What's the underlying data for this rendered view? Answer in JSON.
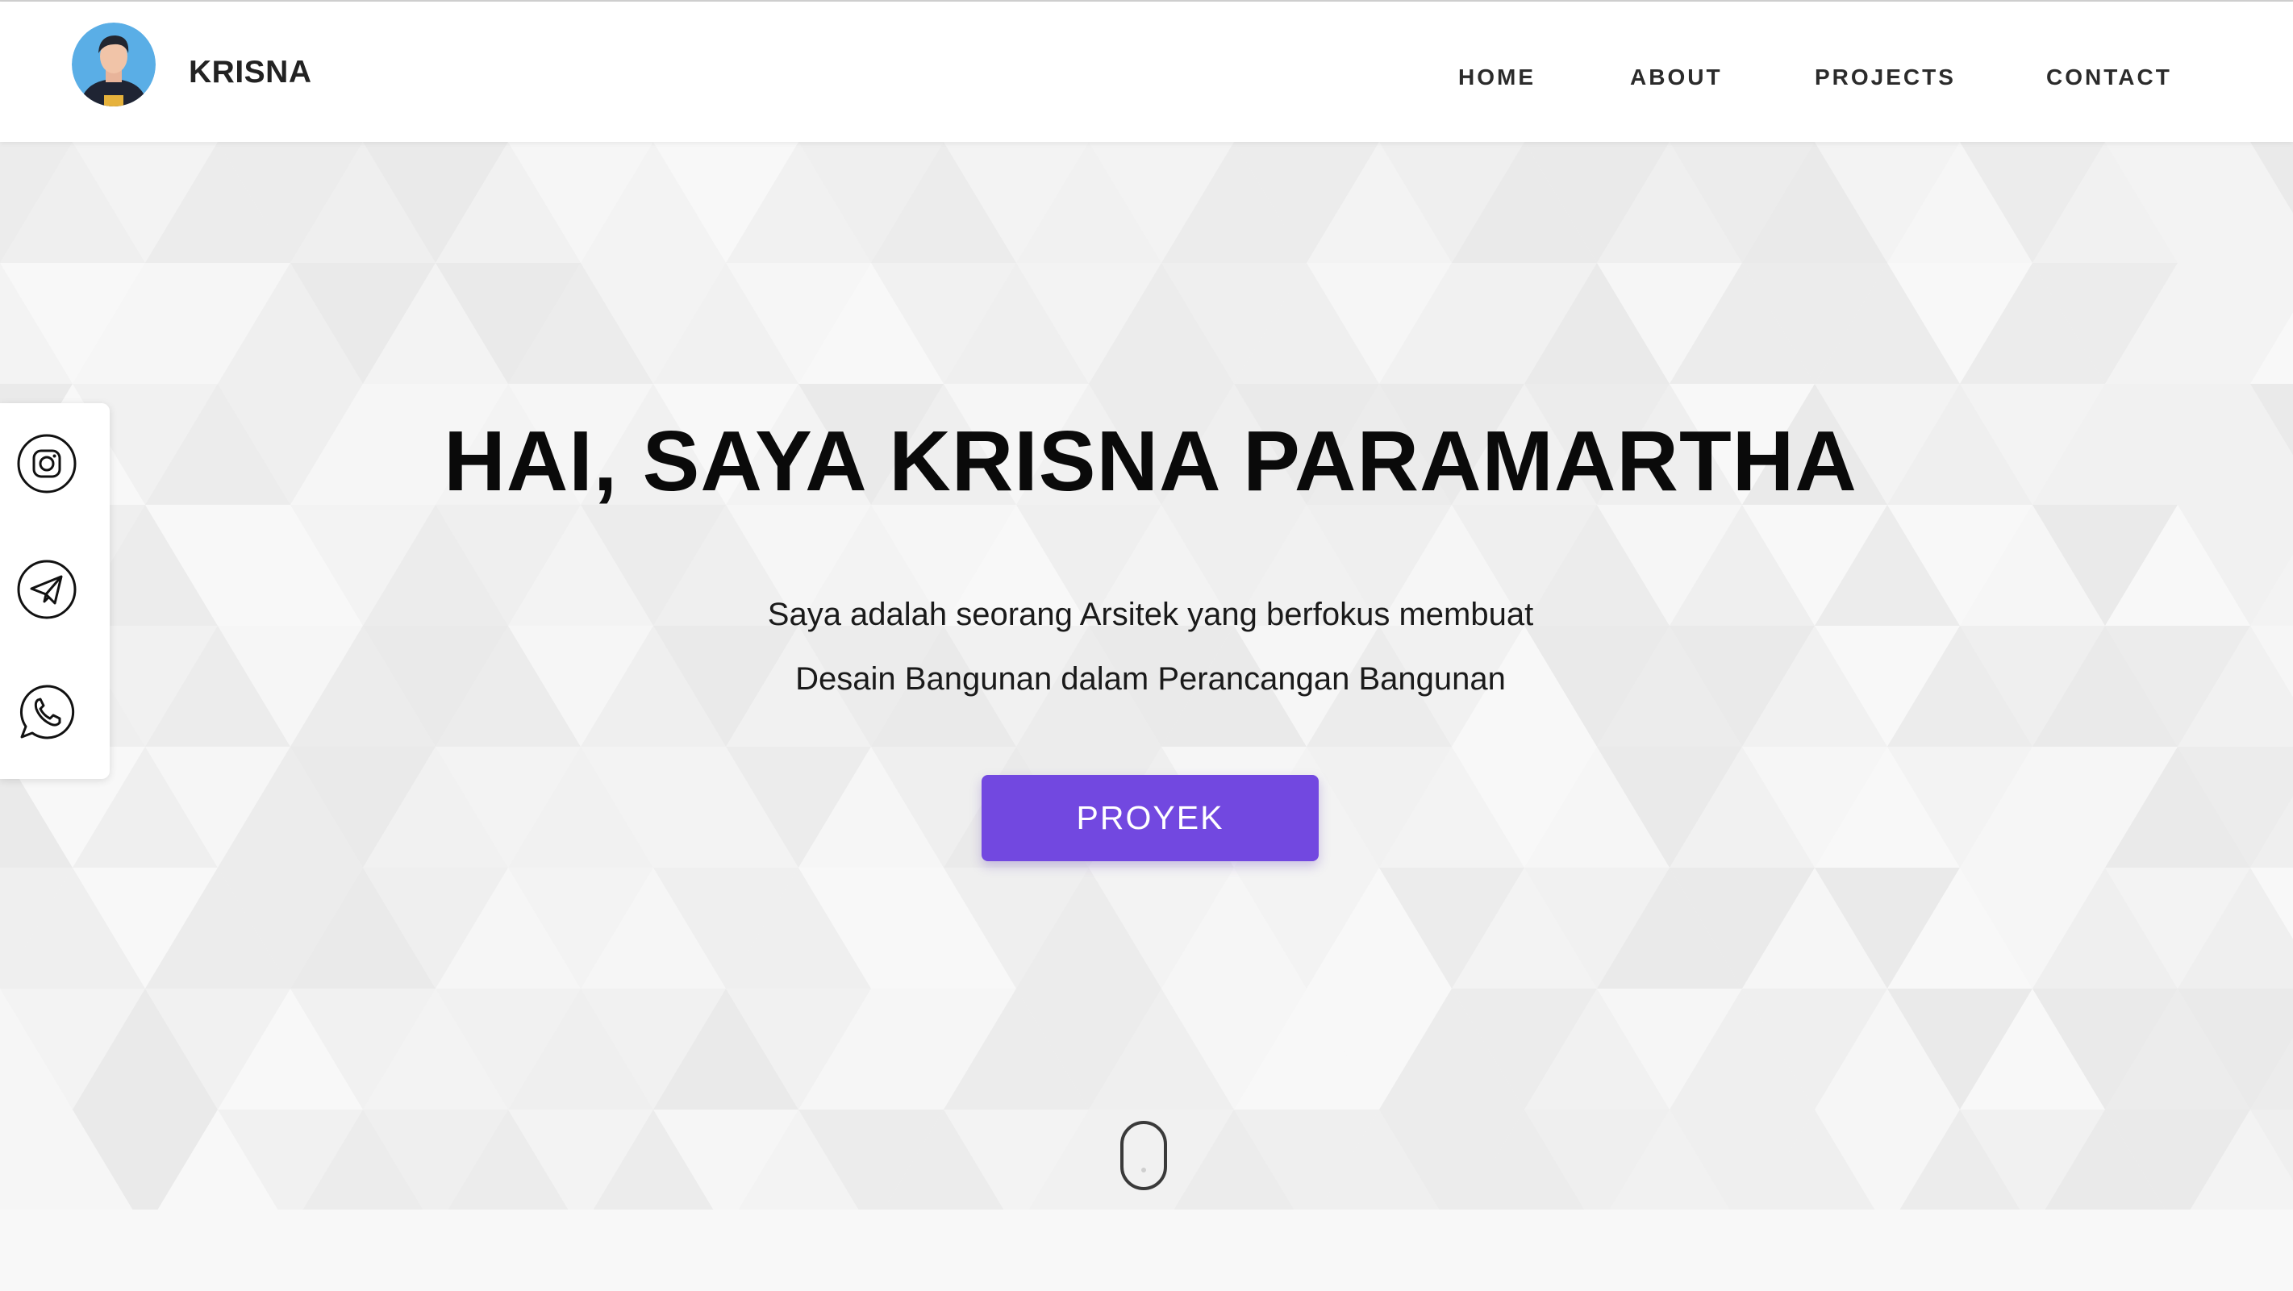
{
  "header": {
    "brand": "KRISNA",
    "avatar_icon": "user-avatar-icon",
    "nav": [
      {
        "label": "HOME"
      },
      {
        "label": "ABOUT"
      },
      {
        "label": "PROJECTS"
      },
      {
        "label": "CONTACT"
      }
    ]
  },
  "social": [
    {
      "icon": "instagram-icon"
    },
    {
      "icon": "telegram-icon"
    },
    {
      "icon": "whatsapp-icon"
    }
  ],
  "hero": {
    "title": "HAI, SAYA KRISNA PARAMARTHA",
    "subtitle_line1": "Saya adalah seorang Arsitek yang berfokus membuat",
    "subtitle_line2": "Desain Bangunan dalam Perancangan Bangunan",
    "cta_label": "PROYEK",
    "scroll_icon": "mouse-scroll-icon"
  },
  "colors": {
    "accent": "#7248e0",
    "text": "#0a0a0a",
    "background": "#f2f2f2"
  }
}
